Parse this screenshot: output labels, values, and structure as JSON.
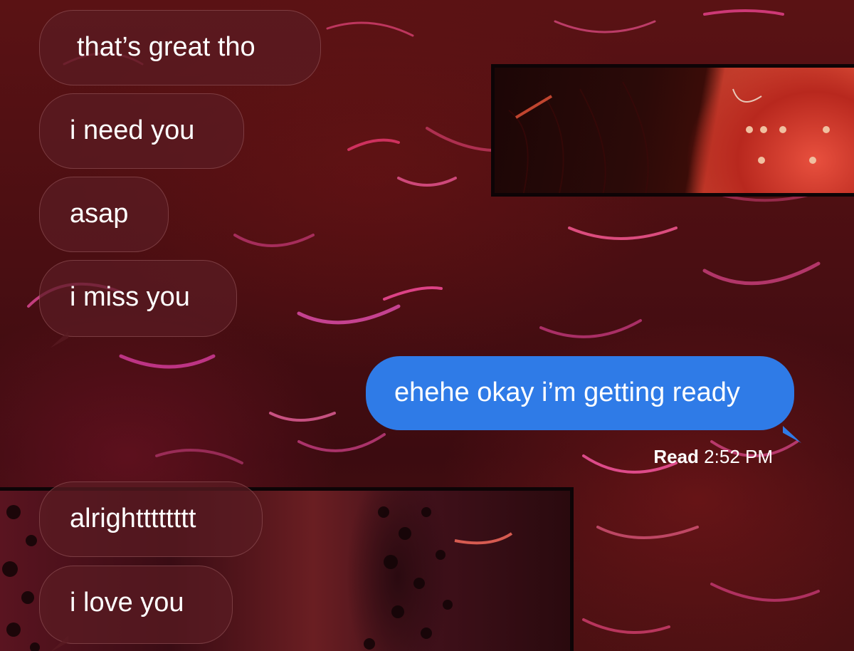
{
  "conversation": {
    "received_top": [
      {
        "text": "that’s great tho"
      },
      {
        "text": "i need you"
      },
      {
        "text": "asap"
      },
      {
        "text": "i miss you"
      }
    ],
    "sent": [
      {
        "text": "ehehe okay i’m getting ready"
      }
    ],
    "read_receipt": {
      "label": "Read",
      "time": "2:52 PM"
    },
    "received_bottom": [
      {
        "text": "alrightttttttt"
      },
      {
        "text": "i love you"
      }
    ]
  },
  "colors": {
    "sent_bubble": "#2f7be7",
    "received_bubble": "#5a1c22",
    "background": "#4a0e12",
    "text": "#ffffff"
  }
}
